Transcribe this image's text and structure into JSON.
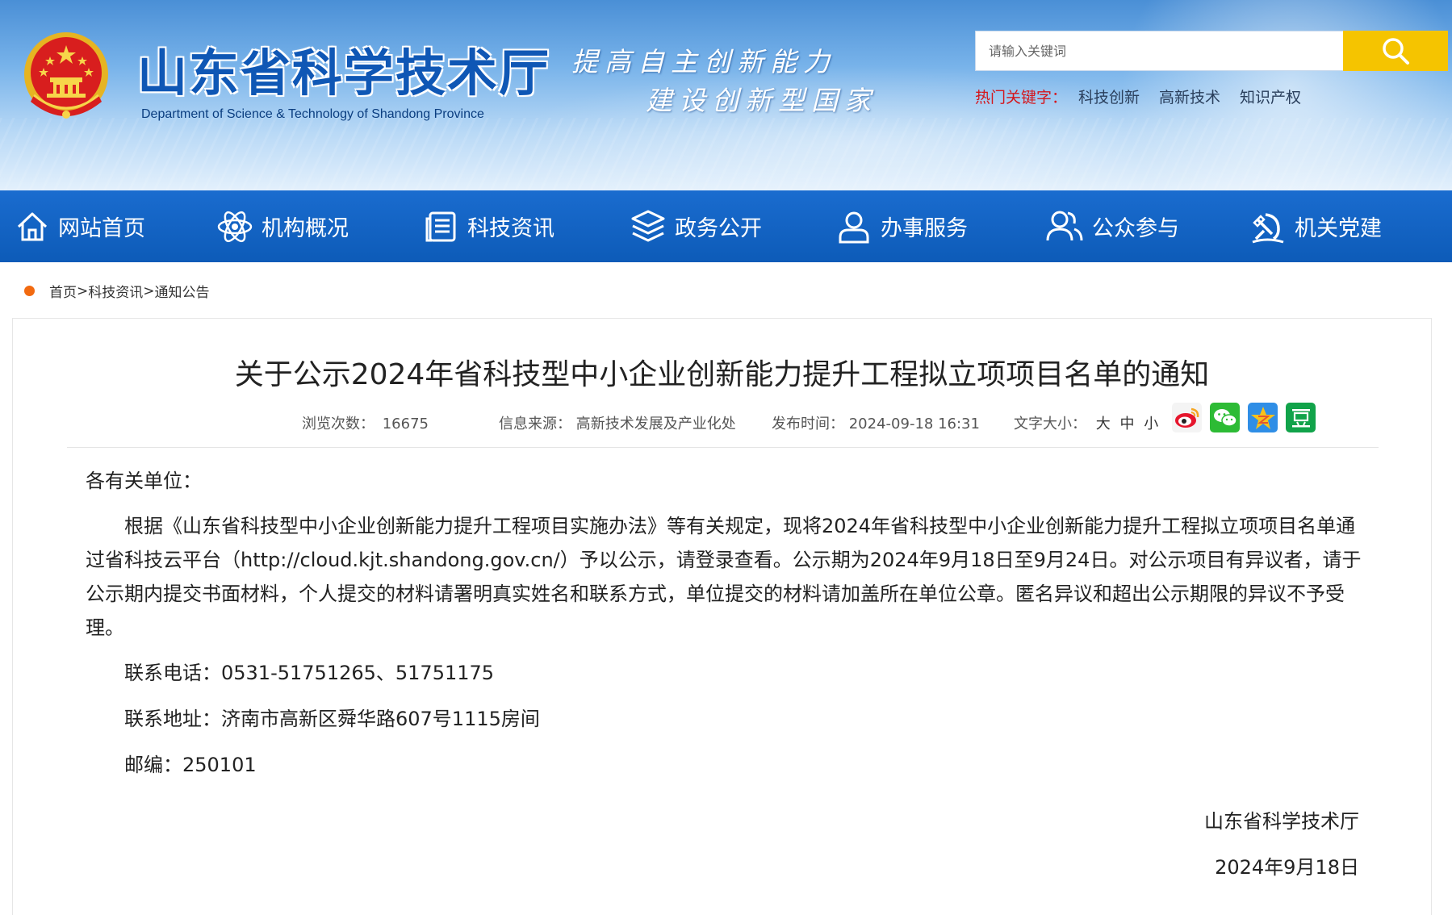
{
  "header": {
    "site_title": "山东省科学技术厅",
    "site_subtitle": "Department of Science & Technology of Shandong Province",
    "slogan_line1": "提高自主创新能力",
    "slogan_line2": "建设创新型国家",
    "search": {
      "placeholder": "请输入关键词"
    },
    "hot_label": "热门关键字：",
    "hot_words": [
      "科技创新",
      "高新技术",
      "知识产权"
    ],
    "colors": {
      "search_button": "#f5c400",
      "hot_label": "#d4161c"
    }
  },
  "nav": {
    "items": [
      {
        "label": "网站首页",
        "icon": "home-icon"
      },
      {
        "label": "机构概况",
        "icon": "atom-icon"
      },
      {
        "label": "科技资讯",
        "icon": "news-icon"
      },
      {
        "label": "政务公开",
        "icon": "layers-icon"
      },
      {
        "label": "办事服务",
        "icon": "user-icon"
      },
      {
        "label": "公众参与",
        "icon": "users-icon"
      },
      {
        "label": "机关党建",
        "icon": "party-icon"
      }
    ],
    "color": "#0d5bb8"
  },
  "breadcrumb": {
    "items": [
      "首页",
      "科技资讯",
      "通知公告"
    ],
    "separator": ">"
  },
  "article": {
    "title": "关于公示2024年省科技型中小企业创新能力提升工程拟立项项目名单的通知",
    "meta": {
      "views_label": "浏览次数：",
      "views_value": "16675",
      "source_label": "信息来源：",
      "source_value": "高新技术发展及产业化处",
      "time_label": "发布时间：",
      "time_value": "2024-09-18 16:31",
      "fontsize_label": "文字大小：",
      "fontsize_large": "大",
      "fontsize_medium": "中",
      "fontsize_small": "小"
    },
    "share_icons": [
      "weibo-icon",
      "wechat-icon",
      "qzone-icon",
      "douban-icon"
    ],
    "greeting": "各有关单位：",
    "paragraph": "根据《山东省科技型中小企业创新能力提升工程项目实施办法》等有关规定，现将2024年省科技型中小企业创新能力提升工程拟立项项目名单通过省科技云平台（http://cloud.kjt.shandong.gov.cn/）予以公示，请登录查看。公示期为2024年9月18日至9月24日。对公示项目有异议者，请于公示期内提交书面材料，个人提交的材料请署明真实姓名和联系方式，单位提交的材料请加盖所在单位公章。匿名异议和超出公示期限的异议不予受理。",
    "phone": "联系电话：0531-51751265、51751175",
    "address": "联系地址：济南市高新区舜华路607号1115房间",
    "postcode": "邮编：250101",
    "signature": "山东省科学技术厅",
    "date": "2024年9月18日"
  }
}
